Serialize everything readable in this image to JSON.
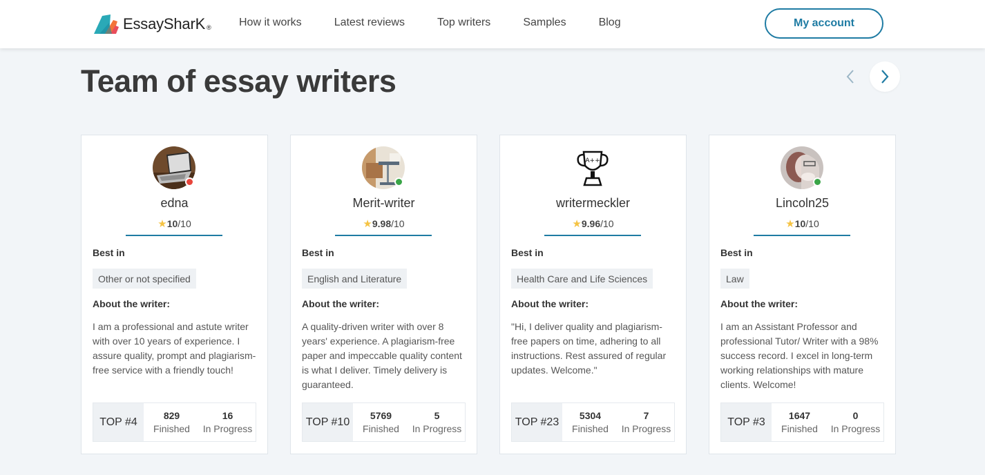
{
  "header": {
    "brand": "EssaySharK",
    "brand_reg": "®",
    "nav": [
      "How it works",
      "Latest reviews",
      "Top writers",
      "Samples",
      "Blog"
    ],
    "account_label": "My account",
    "brand_colors": {
      "accent": "#1e7ba3",
      "logo_teal": "#2aa9b7",
      "logo_orange": "#f3743a"
    }
  },
  "section": {
    "title": "Team of essay writers",
    "prev_icon": "chevron-left-icon",
    "next_icon": "chevron-right-icon"
  },
  "labels": {
    "best_in": "Best in",
    "about": "About the writer:",
    "finished": "Finished",
    "in_progress": "In Progress",
    "rating_max": "/10",
    "star": "★"
  },
  "status_colors": {
    "offline": "#e8453c",
    "online": "#3aa547"
  },
  "writers": [
    {
      "name": "edna",
      "status": "offline",
      "rating": "10",
      "best_in": "Other or not specified",
      "about": "I am a professional and astute writer with over 10 years of experience. I assure quality, prompt and plagiarism-free service with a friendly touch!",
      "top": "TOP #4",
      "finished": "829",
      "in_progress": "16",
      "avatar": "laptop-photo"
    },
    {
      "name": "Merit-writer",
      "status": "online",
      "rating": "9.98",
      "best_in": "English and Literature",
      "about": "A quality-driven writer with over 8 years' experience. A plagiarism-free paper and impeccable quality content is what I deliver. Timely delivery is guaranteed.",
      "top": "TOP #10",
      "finished": "5769",
      "in_progress": "5",
      "avatar": "desk-photo"
    },
    {
      "name": "writermeckler",
      "status": "none",
      "rating": "9.96",
      "best_in": "Health Care and Life Sciences",
      "about": "\"Hi, I deliver quality and plagiarism-free papers on time, adhering to all instructions. Rest assured of regular updates. Welcome.\"",
      "top": "TOP #23",
      "finished": "5304",
      "in_progress": "7",
      "avatar": "trophy-drawing"
    },
    {
      "name": "Lincoln25",
      "status": "online",
      "rating": "10",
      "best_in": "Law",
      "about": "I am an Assistant Professor and professional Tutor/ Writer with a 98% success record. I excel in long-term working relationships with mature clients. Welcome!",
      "top": "TOP #3",
      "finished": "1647",
      "in_progress": "0",
      "avatar": "portrait-photo"
    }
  ]
}
